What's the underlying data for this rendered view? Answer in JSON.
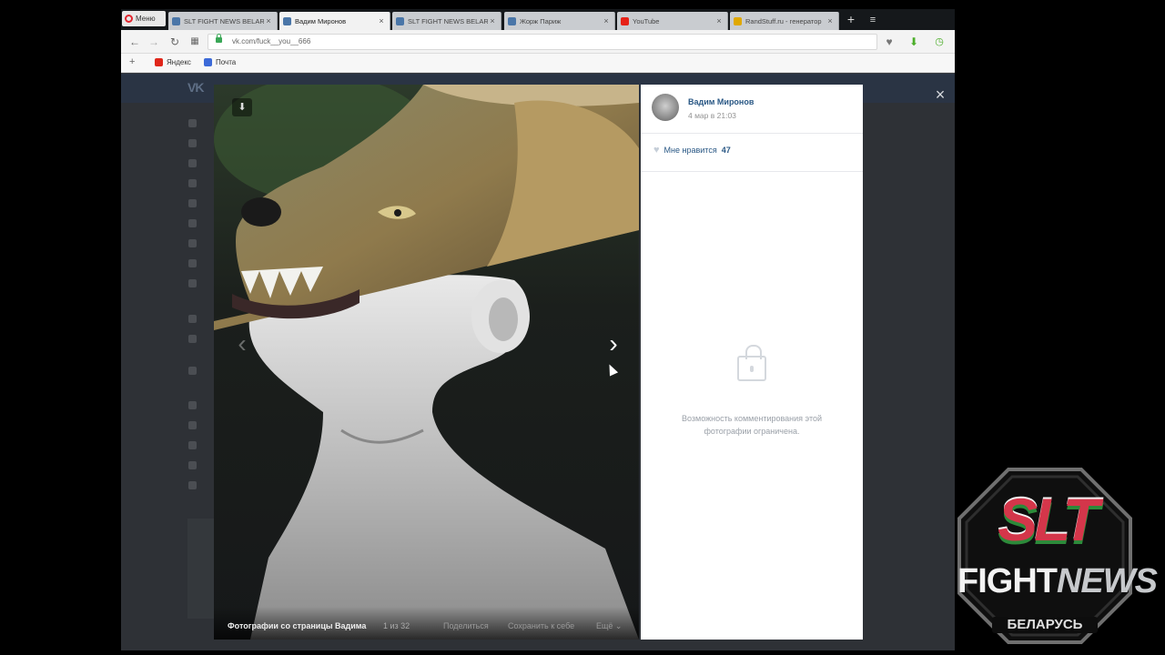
{
  "browser": {
    "menu_label": "Меню",
    "tabs": [
      {
        "title": "SLT FIGHT NEWS BELARUS",
        "favicon_color": "#4a76a8",
        "active": false
      },
      {
        "title": "Вадим Миронов",
        "favicon_color": "#4a76a8",
        "active": true
      },
      {
        "title": "SLT FIGHT NEWS BELARUS",
        "favicon_color": "#4a76a8",
        "active": false
      },
      {
        "title": "Жорж Париж",
        "favicon_color": "#4a76a8",
        "active": false
      },
      {
        "title": "YouTube",
        "favicon_color": "#e62117",
        "active": false
      },
      {
        "title": "RandStuff.ru - генератор",
        "favicon_color": "#e0a800",
        "active": false
      }
    ],
    "new_tab_icon": "+",
    "tab_menu_icon": "≡",
    "url": "vk.com/fuck__you__666",
    "bookmarks": [
      {
        "label": "Яндекс",
        "icon_color": "#e0261a"
      },
      {
        "label": "Почта",
        "icon_color": "#3c6ad8"
      }
    ]
  },
  "viewer": {
    "download_icon": "⬇",
    "prev_icon": "‹",
    "next_icon": "›",
    "album_label": "Фотографии со страницы Вадима",
    "counter": "1 из 32",
    "actions": [
      "Поделиться",
      "Сохранить к себе",
      "Ещё ⌄"
    ],
    "close_icon": "×"
  },
  "side": {
    "author": "Вадим Миронов",
    "date": "4 мар в 21:03",
    "like_label": "Мне нравится",
    "like_count": "47",
    "comments_restricted": "Возможность комментирования этой фотографии ограничена."
  },
  "watermark": {
    "brand": "SLT",
    "fight": "FIGHT",
    "news": "NEWS",
    "country": "БЕЛАРУСЬ",
    "colors": {
      "red": "#d4364a",
      "green": "#2c8a3a",
      "white": "#f2f2f2"
    }
  }
}
